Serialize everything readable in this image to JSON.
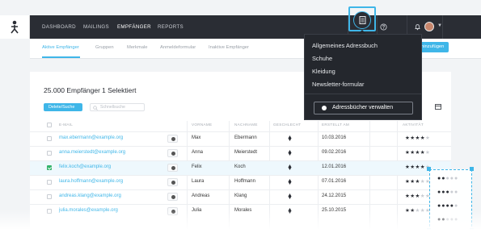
{
  "nav": {
    "items": [
      "DASHBOARD",
      "MAILINGS",
      "EMPFÄNGER",
      "REPORTS"
    ],
    "active_index": 2
  },
  "subnav": {
    "items": [
      "Aktive Empfänger",
      "Gruppen",
      "Merkmale",
      "Anmeldeformular",
      "Inaktive Empfänger"
    ],
    "active_index": 0,
    "add_button": "hinzufügen"
  },
  "summary": {
    "count": "25.000 Empfänger",
    "selected": "1 Selektiert"
  },
  "toolbar": {
    "delete_label": "Delete/Suche",
    "search_placeholder": "Schnellsuche"
  },
  "table": {
    "columns": [
      "E-Mail",
      "Vorname",
      "Nachname",
      "Geschlecht",
      "Erstellt am",
      "Aktivität"
    ],
    "rows": [
      {
        "email": "max.ebermann@example.org",
        "first": "Max",
        "last": "Ebermann",
        "date": "10.03.2016",
        "rating": 4,
        "checked": false
      },
      {
        "email": "anna.meierstedt@example.org",
        "first": "Anna",
        "last": "Meierstedt",
        "date": "09.02.2016",
        "rating": 4,
        "checked": false
      },
      {
        "email": "felix.koch@example.org",
        "first": "Felix",
        "last": "Koch",
        "date": "12.01.2016",
        "rating": 4,
        "checked": true
      },
      {
        "email": "laura.hoffmann@example.org",
        "first": "Laura",
        "last": "Hoffmann",
        "date": "07.01.2016",
        "rating": 3,
        "checked": false
      },
      {
        "email": "andreas.klang@example.org",
        "first": "Andreas",
        "last": "Klang",
        "date": "24.12.2015",
        "rating": 3,
        "checked": false
      },
      {
        "email": "julia.morales@example.org",
        "first": "Julia",
        "last": "Morales",
        "date": "25.10.2015",
        "rating": 2,
        "checked": false
      }
    ]
  },
  "address_book_menu": {
    "items": [
      "Allgemeines Adressbuch",
      "Schuhe",
      "Kleidung",
      "Newsletter-formular"
    ],
    "manage_button": "Adressbücher verwalten"
  },
  "sketch_ratings": [
    2,
    3,
    4,
    2
  ],
  "colors": {
    "accent": "#3fb6e8",
    "topbar": "#2a2d34",
    "checked": "#34b36b"
  },
  "icons": [
    "user-logo-icon",
    "address-book-icon",
    "help-icon",
    "bell-icon",
    "avatar",
    "search-icon",
    "gear-icon",
    "export-icon",
    "female-icon",
    "male-icon"
  ]
}
